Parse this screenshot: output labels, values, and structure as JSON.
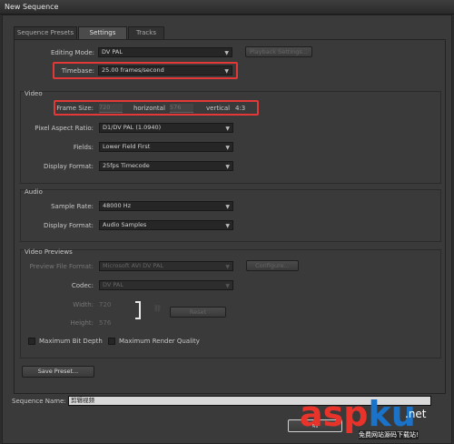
{
  "window": {
    "title": "New Sequence"
  },
  "tabs": [
    {
      "label": "Sequence Presets",
      "active": false
    },
    {
      "label": "Settings",
      "active": true
    },
    {
      "label": "Tracks",
      "active": false
    }
  ],
  "settings": {
    "editing_mode": {
      "label": "Editing Mode:",
      "value": "DV PAL"
    },
    "playback_settings_button": "Playback Settings...",
    "timebase": {
      "label": "Timebase:",
      "value": "25.00 frames/second"
    },
    "video": {
      "group_title": "Video",
      "frame_size": {
        "label": "Frame Size:",
        "width": "720",
        "horizontal_label": "horizontal",
        "height": "576",
        "vertical_label": "vertical",
        "aspect": "4:3"
      },
      "pixel_aspect_ratio": {
        "label": "Pixel Aspect Ratio:",
        "value": "D1/DV PAL (1.0940)"
      },
      "fields": {
        "label": "Fields:",
        "value": "Lower Field First"
      },
      "display_format": {
        "label": "Display Format:",
        "value": "25fps Timecode"
      }
    },
    "audio": {
      "group_title": "Audio",
      "sample_rate": {
        "label": "Sample Rate:",
        "value": "48000 Hz"
      },
      "display_format": {
        "label": "Display Format:",
        "value": "Audio Samples"
      }
    },
    "video_previews": {
      "group_title": "Video Previews",
      "preview_file_format": {
        "label": "Preview File Format:",
        "value": "Microsoft AVI DV PAL"
      },
      "configure_button": "Configure...",
      "codec": {
        "label": "Codec:",
        "value": "DV PAL"
      },
      "width": {
        "label": "Width:",
        "value": "720"
      },
      "height": {
        "label": "Height:",
        "value": "576"
      },
      "reset_button": "Reset",
      "max_bit_depth": "Maximum Bit Depth",
      "max_render_quality": "Maximum Render Quality"
    },
    "save_preset_button": "Save Preset..."
  },
  "footer": {
    "sequence_name_label": "Sequence Name:",
    "sequence_name_value": "剪辑视频",
    "ok_button": "确"
  },
  "watermark": {
    "text_asp": "asp",
    "text_ku": "ku",
    "suffix": ".net",
    "subtitle": "免费网站源码下载站!"
  },
  "colors": {
    "highlight": "#e23838",
    "watermark_red": "#e8332b",
    "watermark_blue": "#1a73c8"
  }
}
